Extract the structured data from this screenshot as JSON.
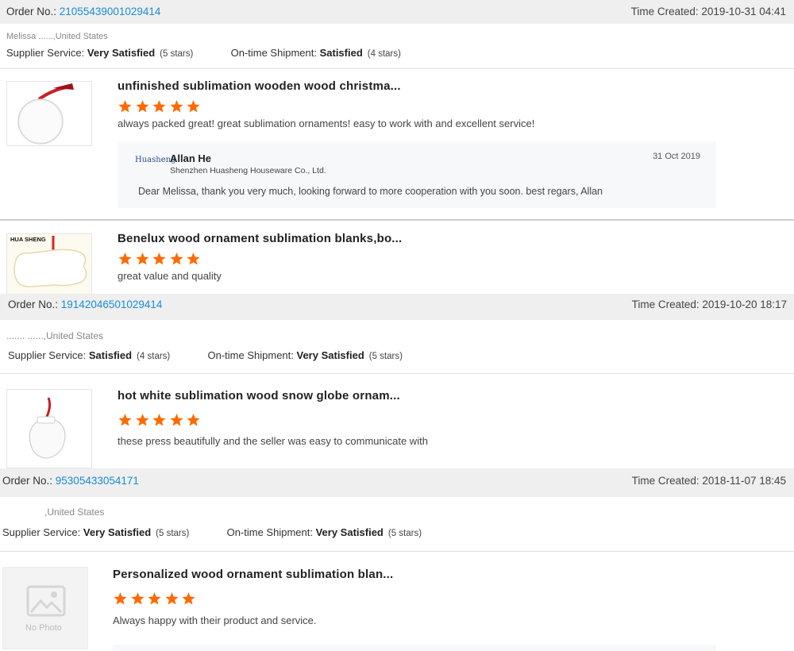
{
  "labels": {
    "order_no": "Order No.: ",
    "time_created": "Time Created: ",
    "supplier_service": "Supplier Service: ",
    "on_time_shipment": "On-time Shipment: "
  },
  "orders": [
    {
      "order_no": "21055439001029414",
      "time_created": "2019-10-31 04:41",
      "buyer": "Melissa ......,United States",
      "supplier_rating": "Very Satisfied",
      "supplier_stars": "(5 stars)",
      "shipment_rating": "Satisfied",
      "shipment_stars": "(4 stars)",
      "items": [
        {
          "title": "unfinished sublimation wooden wood christma...",
          "stars": 5,
          "comment": "always packed great! great sublimation ornaments! easy to work with and excellent service!",
          "reply": {
            "logo_text": "Huasheng",
            "name": "Allan He",
            "company": "Shenzhen Huasheng Houseware Co., Ltd.",
            "date": "31 Oct 2019",
            "message": "Dear Melissa, thank you very much, looking forward to more cooperation with you soon. best regars, Allan"
          }
        },
        {
          "title": "Benelux wood ornament sublimation blanks,bo...",
          "thumb_label": "HUA SHENG",
          "stars": 5,
          "comment": "great value and quality"
        }
      ]
    },
    {
      "order_no": "19142046501029414",
      "time_created": "2019-10-20 18:17",
      "buyer": "....... ......,United States",
      "supplier_rating": "Satisfied",
      "supplier_stars": "(4 stars)",
      "shipment_rating": "Very Satisfied",
      "shipment_stars": "(5 stars)",
      "items": [
        {
          "title": "hot white sublimation wood snow globe ornam...",
          "stars": 5,
          "comment": "these press beautifully and the seller was easy to communicate with"
        }
      ]
    },
    {
      "order_no": "95305433054171",
      "time_created": "2018-11-07 18:45",
      "buyer": ",United States",
      "supplier_rating": "Very Satisfied",
      "supplier_stars": "(5 stars)",
      "shipment_rating": "Very Satisfied",
      "shipment_stars": "(5 stars)",
      "items": [
        {
          "title": "Personalized wood ornament sublimation blan...",
          "stars": 5,
          "comment": "Always happy with their product and service.",
          "no_photo_label": "No Photo"
        }
      ]
    }
  ],
  "colors": {
    "star": "#ff6a00",
    "link": "#1a8cd8",
    "bar": "#efefef"
  }
}
